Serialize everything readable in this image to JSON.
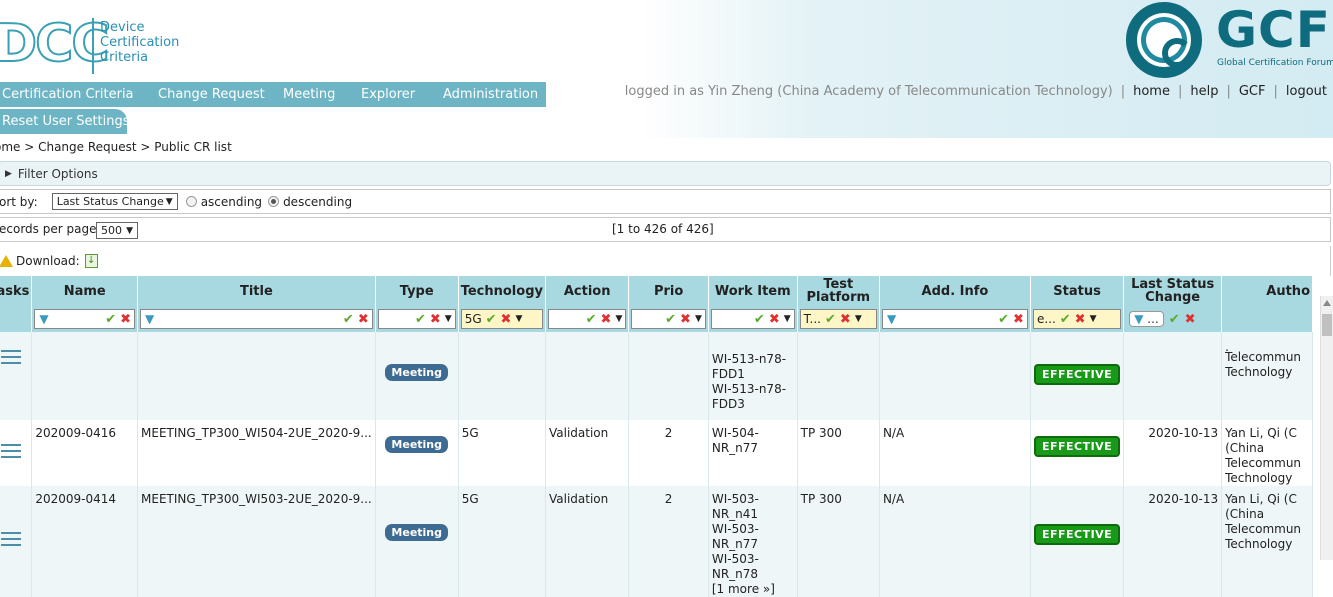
{
  "logo_dcc": {
    "letters": "DCC",
    "line1": "Device",
    "line2": "Certification",
    "line3": "Criteria"
  },
  "logo_gcf": {
    "letters": "GCF",
    "subtitle": "Global Certification Forum"
  },
  "nav": [
    "Certification Criteria",
    "Change Request",
    "Meeting",
    "Explorer",
    "Administration"
  ],
  "subnav": {
    "label": "Reset User Settings"
  },
  "userbar": {
    "text": "logged in as Yin Zheng (China Academy of Telecommunication Technology)",
    "links": [
      "home",
      "help",
      "GCF",
      "logout"
    ],
    "sep": "|"
  },
  "breadcrumb": "ome > Change Request > Public CR list",
  "filter_options": {
    "label": "Filter Options"
  },
  "sort": {
    "label": "ort by:",
    "selected": "Last Status Change",
    "asc": "ascending",
    "desc": "descending",
    "active": "descending"
  },
  "records": {
    "label": "ecords per page",
    "selected": "500",
    "range": "[1 to 426 of 426]"
  },
  "download": {
    "label": "Download:"
  },
  "table": {
    "columns": [
      "asks",
      "Name",
      "Title",
      "Type",
      "Technology",
      "Action",
      "Prio",
      "Work Item",
      "Test Platform",
      "Add. Info",
      "Status",
      "Last Status Change",
      "Autho"
    ],
    "filters": {
      "technology": "5G",
      "test_platform": "T...",
      "status": "e...",
      "last_change": "..."
    },
    "rows": [
      {
        "name": "",
        "title": "",
        "type": "Meeting",
        "technology": "",
        "action": "",
        "prio": "",
        "work_item": [
          "WI-513-n78-",
          "FDD1",
          "WI-513-n78-",
          "FDD3"
        ],
        "platform": "",
        "info": "",
        "status": "EFFECTIVE",
        "last_change": "",
        "author": [
          ".",
          "Telecommun",
          "Technology"
        ]
      },
      {
        "name": "202009-0416",
        "title": "MEETING_TP300_WI504-2UE_2020-9...",
        "type": "Meeting",
        "technology": "5G",
        "action": "Validation",
        "prio": "2",
        "work_item": [
          "WI-504-",
          "NR_n77"
        ],
        "platform": "TP 300",
        "info": "N/A",
        "status": "EFFECTIVE",
        "last_change": "2020-10-13",
        "author": [
          "Yan Li, Qi (C",
          "(China",
          "Telecommun",
          "Technology"
        ]
      },
      {
        "name": "202009-0414",
        "title": "MEETING_TP300_WI503-2UE_2020-9...",
        "type": "Meeting",
        "technology": "5G",
        "action": "Validation",
        "prio": "2",
        "work_item": [
          "WI-503-",
          "NR_n41",
          "WI-503-",
          "NR_n77",
          "WI-503-",
          "NR_n78",
          "[1 more »]"
        ],
        "platform": "TP 300",
        "info": "N/A",
        "status": "EFFECTIVE",
        "last_change": "2020-10-13",
        "author": [
          "Yan Li, Qi (C",
          "(China",
          "Telecommun",
          "Technology"
        ]
      }
    ]
  }
}
